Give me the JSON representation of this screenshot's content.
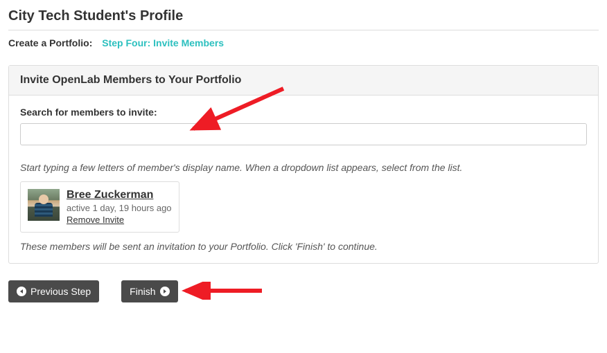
{
  "page_title": "City Tech Student's Profile",
  "breadcrumb": {
    "label": "Create a Portfolio:",
    "step": "Step Four: Invite Members"
  },
  "panel": {
    "header": "Invite OpenLab Members to Your Portfolio",
    "search_label": "Search for members to invite:",
    "search_value": "",
    "helper_text": "Start typing a few letters of member's display name. When a dropdown list appears, select from the list.",
    "members": [
      {
        "name": "Bree Zuckerman",
        "active": "active 1 day, 19 hours ago",
        "remove_label": "Remove Invite"
      }
    ],
    "note": "These members will be sent an invitation to your Portfolio. Click 'Finish' to continue."
  },
  "buttons": {
    "previous": "Previous Step",
    "finish": "Finish"
  }
}
